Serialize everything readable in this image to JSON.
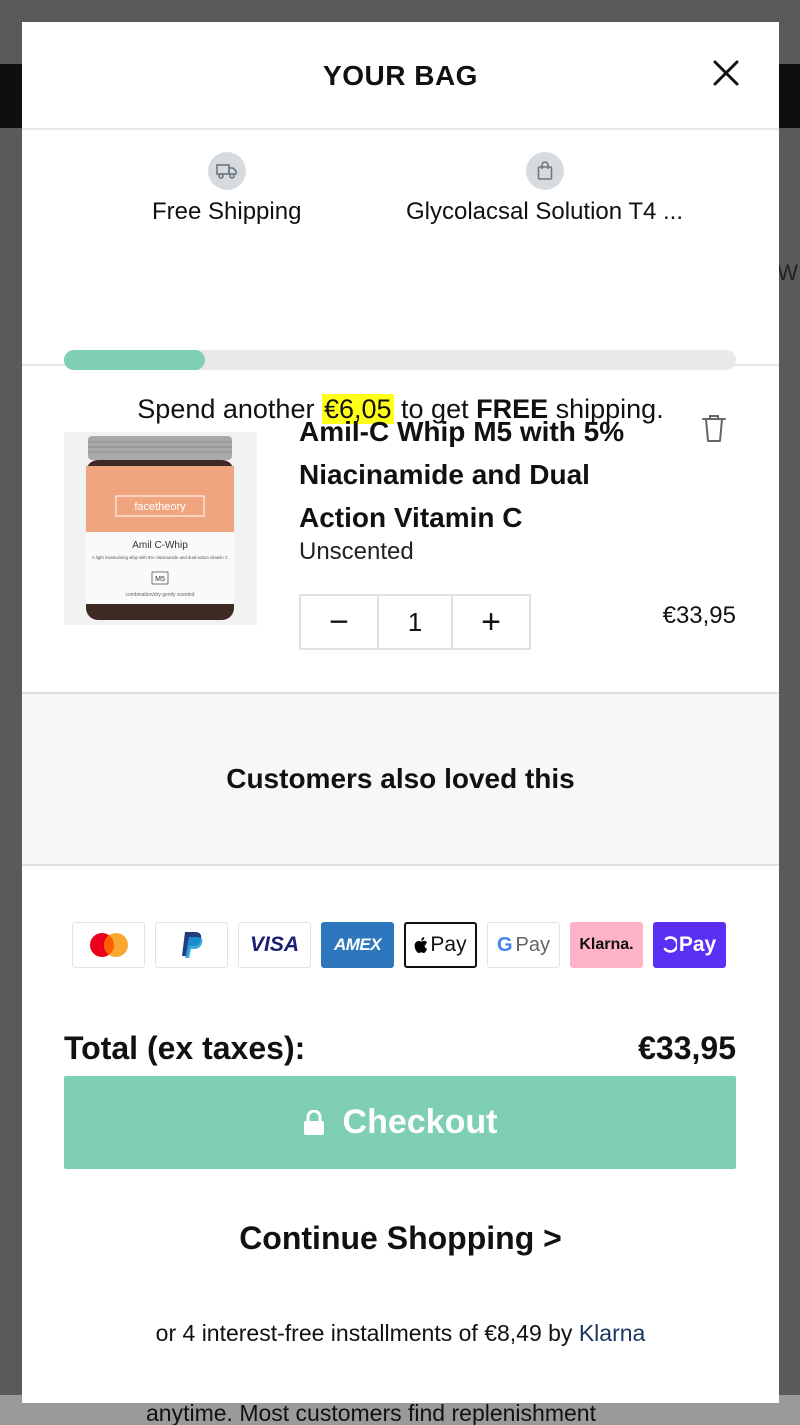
{
  "background": {
    "right_text": "W",
    "bottom_text": "anytime. Most customers find replenishment"
  },
  "header": {
    "title": "YOUR BAG",
    "close_icon": "close-icon"
  },
  "shipping": {
    "milestones": [
      {
        "label": "Free Shipping",
        "icon": "truck-icon"
      },
      {
        "label": "Glycolacsal Solution T4 ...",
        "icon": "shopping-bag-icon"
      }
    ],
    "progress": 0.21,
    "message_prefix": "Spend another ",
    "amount_remaining": "€6,05",
    "message_middle": " to get ",
    "message_bold": "FREE",
    "message_suffix": " shipping."
  },
  "item": {
    "name": "Amil-C Whip M5 with 5% Niacinamide and Dual Action Vitamin C",
    "variant": "Unscented",
    "quantity": "1",
    "decrement": "−",
    "increment": "+",
    "price": "€33,95",
    "image": {
      "brand": "facetheory",
      "product": "Amil C-Whip",
      "description": "A light moisturising whip with 5% niacinamide and dual-action vitamin C",
      "code": "M5",
      "footer": "combination/dry gently scented"
    }
  },
  "recommendations": {
    "title": "Customers also loved this"
  },
  "payments": [
    {
      "name": "Mastercard",
      "icon": "mastercard-icon"
    },
    {
      "name": "PayPal",
      "icon": "paypal-icon"
    },
    {
      "name": "VISA",
      "icon": "visa-icon"
    },
    {
      "name": "AMEX",
      "icon": "amex-icon"
    },
    {
      "name": "Pay",
      "icon": "apple-pay-icon"
    },
    {
      "name": "Pay",
      "icon": "google-pay-icon"
    },
    {
      "name": "Klarna.",
      "icon": "klarna-icon"
    },
    {
      "name": "Pay",
      "icon": "shop-pay-icon"
    }
  ],
  "summary": {
    "total_label": "Total (ex taxes):",
    "total_value": "€33,95",
    "checkout_label": "Checkout",
    "continue_label": "Continue Shopping >",
    "installments_text": "or 4 interest-free installments of €8,49 by ",
    "installments_link": "Klarna"
  },
  "colors": {
    "accent": "#7ecfb5",
    "highlight": "#ffff1a",
    "amex": "#2e77bc",
    "klarna": "#ffb3c7",
    "shop_pay": "#5a31f4"
  }
}
